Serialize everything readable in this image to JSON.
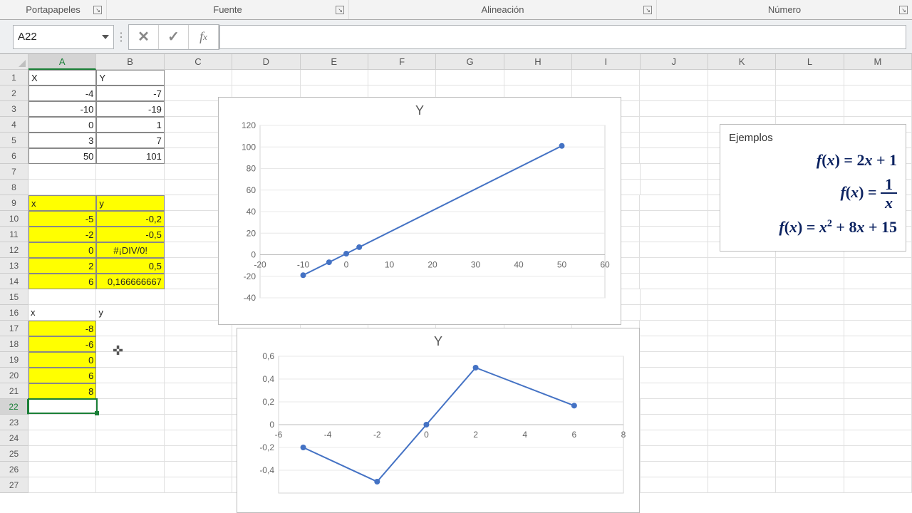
{
  "ribbon_groups": [
    "Portapapeles",
    "Fuente",
    "Alineación",
    "Número"
  ],
  "name_box": "A22",
  "columns": [
    "A",
    "B",
    "C",
    "D",
    "E",
    "F",
    "G",
    "H",
    "I",
    "J",
    "K",
    "L",
    "M"
  ],
  "rows": 27,
  "active_cell": {
    "col": "A",
    "row": 22
  },
  "tables": {
    "t1": {
      "header": {
        "A": "X",
        "B": "Y"
      },
      "rows": [
        {
          "A": "-4",
          "B": "-7"
        },
        {
          "A": "-10",
          "B": "-19"
        },
        {
          "A": "0",
          "B": "1"
        },
        {
          "A": "3",
          "B": "7"
        },
        {
          "A": "50",
          "B": "101"
        }
      ]
    },
    "t2": {
      "header": {
        "A": "x",
        "B": "y"
      },
      "rows": [
        {
          "A": "-5",
          "B": "-0,2"
        },
        {
          "A": "-2",
          "B": "-0,5"
        },
        {
          "A": "0",
          "B": "#¡DIV/0!"
        },
        {
          "A": "2",
          "B": "0,5"
        },
        {
          "A": "6",
          "B": "0,166666667"
        }
      ]
    },
    "t3": {
      "header": {
        "A": "x",
        "B": "y"
      },
      "rows": [
        {
          "A": "-8"
        },
        {
          "A": "-6"
        },
        {
          "A": "0"
        },
        {
          "A": "6"
        },
        {
          "A": "8"
        }
      ]
    }
  },
  "math": {
    "title": "Ejemplos",
    "eq1": "f(x) = 2x + 1",
    "eq2": "f(x) = 1/x",
    "eq3": "f(x) = x² + 8x + 15"
  },
  "charts": {
    "chart1": {
      "title": "Y",
      "x_ticks": [
        "-20",
        "-10",
        "0",
        "10",
        "20",
        "30",
        "40",
        "50",
        "60"
      ],
      "y_ticks": [
        "-40",
        "-20",
        "0",
        "20",
        "40",
        "60",
        "80",
        "100",
        "120"
      ]
    },
    "chart2": {
      "title": "Y",
      "x_ticks": [
        "-6",
        "-4",
        "-2",
        "0",
        "2",
        "4",
        "6",
        "8"
      ],
      "y_ticks": [
        "-0,4",
        "-0,2",
        "0",
        "0,2",
        "0,4",
        "0,6"
      ]
    }
  },
  "chart_data": [
    {
      "type": "line",
      "title": "Y",
      "x": [
        -10,
        -4,
        0,
        3,
        50
      ],
      "y": [
        -19,
        -7,
        1,
        7,
        101
      ],
      "xlim": [
        -20,
        60
      ],
      "ylim": [
        -40,
        120
      ]
    },
    {
      "type": "line",
      "title": "Y",
      "x": [
        -5,
        -2,
        0,
        2,
        6
      ],
      "y": [
        -0.2,
        -0.5,
        0,
        0.5,
        0.1666667
      ],
      "xlim": [
        -6,
        8
      ],
      "ylim": [
        -0.6,
        0.6
      ]
    }
  ]
}
